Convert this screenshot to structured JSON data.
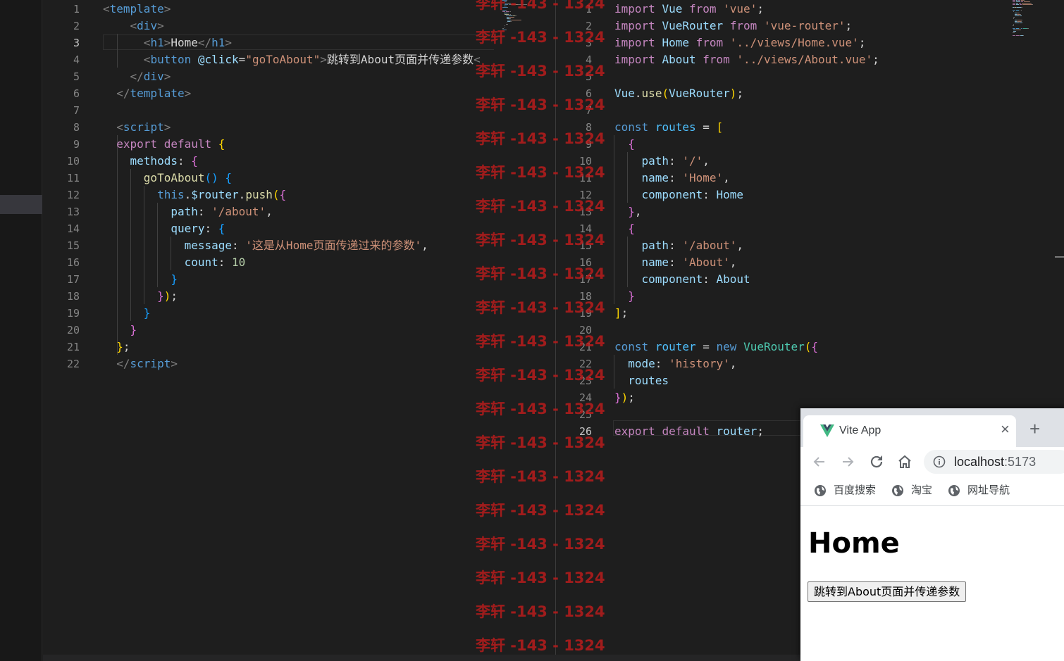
{
  "left_editor": {
    "active_line": 3,
    "lines": [
      [
        [
          "tk-br",
          "<"
        ],
        [
          "tk-tag",
          "template"
        ],
        [
          "tk-br",
          ">"
        ]
      ],
      [
        [
          "tk-txt",
          "    "
        ],
        [
          "tk-br",
          "<"
        ],
        [
          "tk-tag",
          "div"
        ],
        [
          "tk-br",
          ">"
        ]
      ],
      [
        [
          "tk-txt",
          "      "
        ],
        [
          "tk-br",
          "<"
        ],
        [
          "tk-tag",
          "h1"
        ],
        [
          "tk-br",
          ">"
        ],
        [
          "tk-txt",
          "Home"
        ],
        [
          "tk-br",
          "</"
        ],
        [
          "tk-tag",
          "h1"
        ],
        [
          "tk-br",
          ">"
        ]
      ],
      [
        [
          "tk-txt",
          "      "
        ],
        [
          "tk-br",
          "<"
        ],
        [
          "tk-tag",
          "button"
        ],
        [
          "tk-txt",
          " "
        ],
        [
          "tk-att",
          "@click"
        ],
        [
          "tk-txt",
          "="
        ],
        [
          "tk-str",
          "\"goToAbout\""
        ],
        [
          "tk-br",
          ">"
        ],
        [
          "tk-txt",
          "跳转到About页面并传递参数"
        ],
        [
          "tk-br",
          "<"
        ]
      ],
      [
        [
          "tk-txt",
          "    "
        ],
        [
          "tk-br",
          "</"
        ],
        [
          "tk-tag",
          "div"
        ],
        [
          "tk-br",
          ">"
        ]
      ],
      [
        [
          "tk-txt",
          "  "
        ],
        [
          "tk-br",
          "</"
        ],
        [
          "tk-tag",
          "template"
        ],
        [
          "tk-br",
          ">"
        ]
      ],
      [],
      [
        [
          "tk-txt",
          "  "
        ],
        [
          "tk-br",
          "<"
        ],
        [
          "tk-tag",
          "script"
        ],
        [
          "tk-br",
          ">"
        ]
      ],
      [
        [
          "tk-txt",
          "  "
        ],
        [
          "tk-kw",
          "export"
        ],
        [
          "tk-txt",
          " "
        ],
        [
          "tk-kw",
          "default"
        ],
        [
          "tk-txt",
          " "
        ],
        [
          "tk-b1",
          "{"
        ]
      ],
      [
        [
          "tk-txt",
          "    "
        ],
        [
          "tk-prop",
          "methods"
        ],
        [
          "tk-pun",
          ": "
        ],
        [
          "tk-b2",
          "{"
        ]
      ],
      [
        [
          "tk-txt",
          "      "
        ],
        [
          "tk-fn",
          "goToAbout"
        ],
        [
          "tk-b3",
          "()"
        ],
        [
          "tk-txt",
          " "
        ],
        [
          "tk-b3",
          "{"
        ]
      ],
      [
        [
          "tk-txt",
          "        "
        ],
        [
          "tk-blue",
          "this"
        ],
        [
          "tk-pun",
          "."
        ],
        [
          "tk-var",
          "$router"
        ],
        [
          "tk-pun",
          "."
        ],
        [
          "tk-fn",
          "push"
        ],
        [
          "tk-b1",
          "("
        ],
        [
          "tk-b2",
          "{"
        ]
      ],
      [
        [
          "tk-txt",
          "          "
        ],
        [
          "tk-prop",
          "path"
        ],
        [
          "tk-pun",
          ": "
        ],
        [
          "tk-str",
          "'/about'"
        ],
        [
          "tk-pun",
          ","
        ]
      ],
      [
        [
          "tk-txt",
          "          "
        ],
        [
          "tk-prop",
          "query"
        ],
        [
          "tk-pun",
          ": "
        ],
        [
          "tk-b3",
          "{"
        ]
      ],
      [
        [
          "tk-txt",
          "            "
        ],
        [
          "tk-prop",
          "message"
        ],
        [
          "tk-pun",
          ": "
        ],
        [
          "tk-str",
          "'这是从Home页面传递过来的参数'"
        ],
        [
          "tk-pun",
          ","
        ]
      ],
      [
        [
          "tk-txt",
          "            "
        ],
        [
          "tk-prop",
          "count"
        ],
        [
          "tk-pun",
          ": "
        ],
        [
          "tk-num",
          "10"
        ]
      ],
      [
        [
          "tk-txt",
          "          "
        ],
        [
          "tk-b3",
          "}"
        ]
      ],
      [
        [
          "tk-txt",
          "        "
        ],
        [
          "tk-b2",
          "}"
        ],
        [
          "tk-b1",
          ")"
        ],
        [
          "tk-pun",
          ";"
        ]
      ],
      [
        [
          "tk-txt",
          "      "
        ],
        [
          "tk-b3",
          "}"
        ]
      ],
      [
        [
          "tk-txt",
          "    "
        ],
        [
          "tk-b2",
          "}"
        ]
      ],
      [
        [
          "tk-txt",
          "  "
        ],
        [
          "tk-b1",
          "}"
        ],
        [
          "tk-pun",
          ";"
        ]
      ],
      [
        [
          "tk-txt",
          "  "
        ],
        [
          "tk-br",
          "</"
        ],
        [
          "tk-tag",
          "script"
        ],
        [
          "tk-br",
          ">"
        ]
      ]
    ]
  },
  "right_editor": {
    "active_line": 26,
    "lines": [
      [
        [
          "tk-kw",
          "import"
        ],
        [
          "tk-txt",
          " "
        ],
        [
          "tk-var",
          "Vue"
        ],
        [
          "tk-txt",
          " "
        ],
        [
          "tk-kw",
          "from"
        ],
        [
          "tk-txt",
          " "
        ],
        [
          "tk-str",
          "'vue'"
        ],
        [
          "tk-pun",
          ";"
        ]
      ],
      [
        [
          "tk-kw",
          "import"
        ],
        [
          "tk-txt",
          " "
        ],
        [
          "tk-var",
          "VueRouter"
        ],
        [
          "tk-txt",
          " "
        ],
        [
          "tk-kw",
          "from"
        ],
        [
          "tk-txt",
          " "
        ],
        [
          "tk-str",
          "'vue-router'"
        ],
        [
          "tk-pun",
          ";"
        ]
      ],
      [
        [
          "tk-kw",
          "import"
        ],
        [
          "tk-txt",
          " "
        ],
        [
          "tk-var",
          "Home"
        ],
        [
          "tk-txt",
          " "
        ],
        [
          "tk-kw",
          "from"
        ],
        [
          "tk-txt",
          " "
        ],
        [
          "tk-str",
          "'../views/Home.vue'"
        ],
        [
          "tk-pun",
          ";"
        ]
      ],
      [
        [
          "tk-kw",
          "import"
        ],
        [
          "tk-txt",
          " "
        ],
        [
          "tk-var",
          "About"
        ],
        [
          "tk-txt",
          " "
        ],
        [
          "tk-kw",
          "from"
        ],
        [
          "tk-txt",
          " "
        ],
        [
          "tk-str",
          "'../views/About.vue'"
        ],
        [
          "tk-pun",
          ";"
        ]
      ],
      [],
      [
        [
          "tk-var",
          "Vue"
        ],
        [
          "tk-pun",
          "."
        ],
        [
          "tk-fn",
          "use"
        ],
        [
          "tk-b1",
          "("
        ],
        [
          "tk-var",
          "VueRouter"
        ],
        [
          "tk-b1",
          ")"
        ],
        [
          "tk-pun",
          ";"
        ]
      ],
      [],
      [
        [
          "tk-blue",
          "const"
        ],
        [
          "tk-txt",
          " "
        ],
        [
          "tk-const",
          "routes"
        ],
        [
          "tk-txt",
          " "
        ],
        [
          "tk-pun",
          "="
        ],
        [
          "tk-txt",
          " "
        ],
        [
          "tk-b1",
          "["
        ]
      ],
      [
        [
          "tk-txt",
          "  "
        ],
        [
          "tk-b2",
          "{"
        ]
      ],
      [
        [
          "tk-txt",
          "    "
        ],
        [
          "tk-prop",
          "path"
        ],
        [
          "tk-pun",
          ": "
        ],
        [
          "tk-str",
          "'/'"
        ],
        [
          "tk-pun",
          ","
        ]
      ],
      [
        [
          "tk-txt",
          "    "
        ],
        [
          "tk-prop",
          "name"
        ],
        [
          "tk-pun",
          ": "
        ],
        [
          "tk-str",
          "'Home'"
        ],
        [
          "tk-pun",
          ","
        ]
      ],
      [
        [
          "tk-txt",
          "    "
        ],
        [
          "tk-prop",
          "component"
        ],
        [
          "tk-pun",
          ": "
        ],
        [
          "tk-var",
          "Home"
        ]
      ],
      [
        [
          "tk-txt",
          "  "
        ],
        [
          "tk-b2",
          "}"
        ],
        [
          "tk-pun",
          ","
        ]
      ],
      [
        [
          "tk-txt",
          "  "
        ],
        [
          "tk-b2",
          "{"
        ]
      ],
      [
        [
          "tk-txt",
          "    "
        ],
        [
          "tk-prop",
          "path"
        ],
        [
          "tk-pun",
          ": "
        ],
        [
          "tk-str",
          "'/about'"
        ],
        [
          "tk-pun",
          ","
        ]
      ],
      [
        [
          "tk-txt",
          "    "
        ],
        [
          "tk-prop",
          "name"
        ],
        [
          "tk-pun",
          ": "
        ],
        [
          "tk-str",
          "'About'"
        ],
        [
          "tk-pun",
          ","
        ]
      ],
      [
        [
          "tk-txt",
          "    "
        ],
        [
          "tk-prop",
          "component"
        ],
        [
          "tk-pun",
          ": "
        ],
        [
          "tk-var",
          "About"
        ]
      ],
      [
        [
          "tk-txt",
          "  "
        ],
        [
          "tk-b2",
          "}"
        ]
      ],
      [
        [
          "tk-b1",
          "]"
        ],
        [
          "tk-pun",
          ";"
        ]
      ],
      [],
      [
        [
          "tk-blue",
          "const"
        ],
        [
          "tk-txt",
          " "
        ],
        [
          "tk-const",
          "router"
        ],
        [
          "tk-txt",
          " "
        ],
        [
          "tk-pun",
          "="
        ],
        [
          "tk-txt",
          " "
        ],
        [
          "tk-blue",
          "new"
        ],
        [
          "tk-txt",
          " "
        ],
        [
          "tk-cls",
          "VueRouter"
        ],
        [
          "tk-b1",
          "("
        ],
        [
          "tk-b2",
          "{"
        ]
      ],
      [
        [
          "tk-txt",
          "  "
        ],
        [
          "tk-prop",
          "mode"
        ],
        [
          "tk-pun",
          ": "
        ],
        [
          "tk-str",
          "'history'"
        ],
        [
          "tk-pun",
          ","
        ]
      ],
      [
        [
          "tk-txt",
          "  "
        ],
        [
          "tk-var",
          "routes"
        ]
      ],
      [
        [
          "tk-b2",
          "}"
        ],
        [
          "tk-b1",
          ")"
        ],
        [
          "tk-pun",
          ";"
        ]
      ],
      [],
      [
        [
          "tk-kw",
          "export"
        ],
        [
          "tk-txt",
          " "
        ],
        [
          "tk-kw",
          "default"
        ],
        [
          "tk-txt",
          " "
        ],
        [
          "tk-var",
          "router"
        ],
        [
          "tk-pun",
          ";"
        ]
      ]
    ]
  },
  "watermark": {
    "text": "李轩 -143 - 1324",
    "color": "#b81c1c"
  },
  "browser": {
    "tab_title": "Vite App",
    "tab_close_label": "×",
    "new_tab_label": "+",
    "url_host": "localhost",
    "url_port": ":5173",
    "bookmarks": [
      {
        "label": "百度搜索"
      },
      {
        "label": "淘宝"
      },
      {
        "label": "网址导航"
      }
    ],
    "page": {
      "heading": "Home",
      "button_label": "跳转到About页面并传递参数"
    }
  }
}
